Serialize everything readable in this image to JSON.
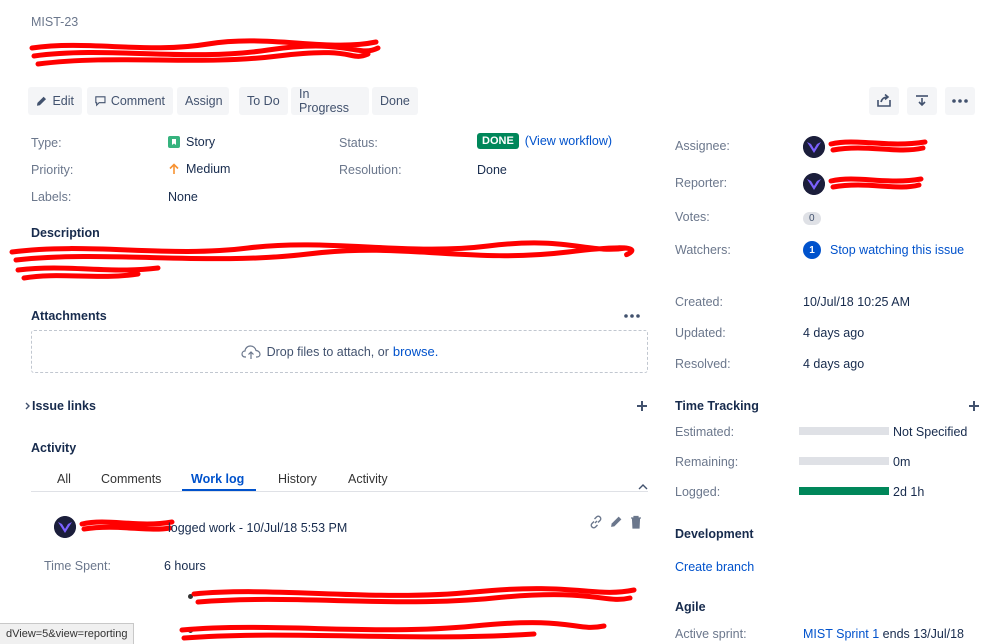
{
  "issue_key": "MIST-23",
  "toolbar": {
    "edit": "Edit",
    "comment": "Comment",
    "assign": "Assign",
    "todo": "To Do",
    "in_progress": "In Progress",
    "done": "Done"
  },
  "details": {
    "type_label": "Type:",
    "type_value": "Story",
    "priority_label": "Priority:",
    "priority_value": "Medium",
    "labels_label": "Labels:",
    "labels_value": "None",
    "status_label": "Status:",
    "status_value": "DONE",
    "view_workflow": "(View workflow)",
    "resolution_label": "Resolution:",
    "resolution_value": "Done"
  },
  "description_title": "Description",
  "attachments": {
    "title": "Attachments",
    "drop_text": "Drop files to attach, or",
    "browse": "browse."
  },
  "issue_links_title": "Issue links",
  "activity": {
    "title": "Activity",
    "tabs": [
      "All",
      "Comments",
      "Work log",
      "History",
      "Activity"
    ],
    "worklog": {
      "action": "logged work - 10/Jul/18 5:53 PM",
      "time_spent_label": "Time Spent:",
      "time_spent_value": "6 hours"
    }
  },
  "people": {
    "assignee_label": "Assignee:",
    "reporter_label": "Reporter:",
    "votes_label": "Votes:",
    "votes_count": "0",
    "watchers_label": "Watchers:",
    "watchers_count": "1",
    "stop_watching": "Stop watching this issue"
  },
  "dates": {
    "created_label": "Created:",
    "created_value": "10/Jul/18 10:25 AM",
    "updated_label": "Updated:",
    "updated_value": "4 days ago",
    "resolved_label": "Resolved:",
    "resolved_value": "4 days ago"
  },
  "time_tracking": {
    "title": "Time Tracking",
    "estimated_label": "Estimated:",
    "estimated_value": "Not Specified",
    "estimated_fraction": 0,
    "remaining_label": "Remaining:",
    "remaining_value": "0m",
    "remaining_fraction": 0,
    "logged_label": "Logged:",
    "logged_value": "2d 1h",
    "logged_fraction": 1
  },
  "development": {
    "title": "Development",
    "create_branch": "Create branch"
  },
  "agile": {
    "title": "Agile",
    "active_sprint_label": "Active sprint:",
    "sprint_link": "MIST Sprint 1",
    "sprint_ends": "ends 13/Jul/18"
  },
  "status_url": "dView=5&view=reporting",
  "colors": {
    "done_green": "#00875a",
    "link_blue": "#0052cc",
    "redaction_red": "#ff0000"
  }
}
